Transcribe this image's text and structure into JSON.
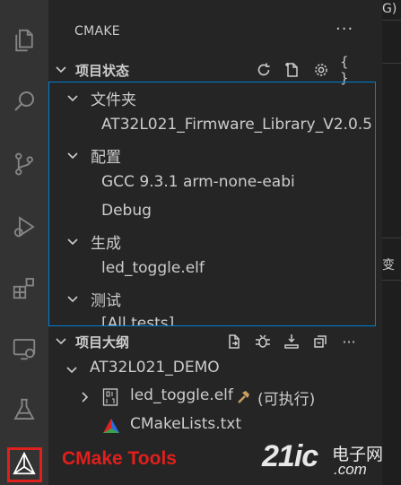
{
  "sidebar": {
    "title": "CMAKE",
    "more": "···"
  },
  "project_status": {
    "title": "项目状态",
    "tools": [
      "refresh-icon",
      "new-file-icon",
      "gear-icon",
      "braces-icon"
    ],
    "braces_glyph": "{ }",
    "folder_label": "文件夹",
    "folder_value": "AT32L021_Firmware_Library_V2.0.5",
    "config_label": "配置",
    "config_kit": "GCC 9.3.1 arm-none-eabi",
    "config_variant": "Debug",
    "build_label": "生成",
    "build_target": "led_toggle.elf",
    "test_label": "测试",
    "test_value": "[All tests]"
  },
  "project_outline": {
    "title": "项目大纲",
    "more": "···",
    "project_name": "AT32L021_DEMO",
    "target_name": "led_toggle.elf",
    "target_kind": "(可执行)",
    "file_name": "CMakeLists.txt"
  },
  "editor_edge": {
    "top_text": "G)",
    "mid_text": "变"
  },
  "annotation": {
    "label": "CMake Tools",
    "color": "#e0201c"
  },
  "watermark": {
    "num": "21ic",
    "cn": "电子网",
    "dom": ".com"
  }
}
